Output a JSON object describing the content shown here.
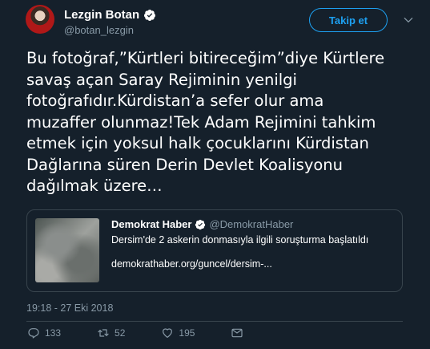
{
  "author": {
    "name": "Lezgin Botan",
    "handle": "@botan_lezgin"
  },
  "follow_label": "Takip et",
  "tweet_text": "Bu fotoğraf,”Kürtleri bitireceğim”diye Kürtlere\nsavaş açan Saray Rejiminin yenilgi\nfotoğrafıdır.Kürdistan’a sefer olur ama\nmuzaffer olunmaz!Tek Adam Rejimini tahkim\netmek için yoksul halk çocuklarını Kürdistan\nDağlarına süren Derin Devlet Koalisyonu\ndağılmak üzere…",
  "quoted_card": {
    "name": "Demokrat Haber",
    "handle": "@DemokratHaber",
    "description": "Dersim'de 2 askerin donmasıyla ilgili soruşturma başlatıldı",
    "link": "demokrathaber.org/guncel/dersim-..."
  },
  "timestamp": "19:18 - 27 Eki 2018",
  "counts": {
    "replies": "133",
    "retweets": "52",
    "likes": "195"
  },
  "colors": {
    "background": "#15202b",
    "accent": "#1da1f2",
    "muted": "#8899a6",
    "border": "#38444d"
  },
  "icons": [
    "verified-badge-icon",
    "chevron-down-icon",
    "reply-icon",
    "retweet-icon",
    "like-icon",
    "direct-message-icon"
  ]
}
